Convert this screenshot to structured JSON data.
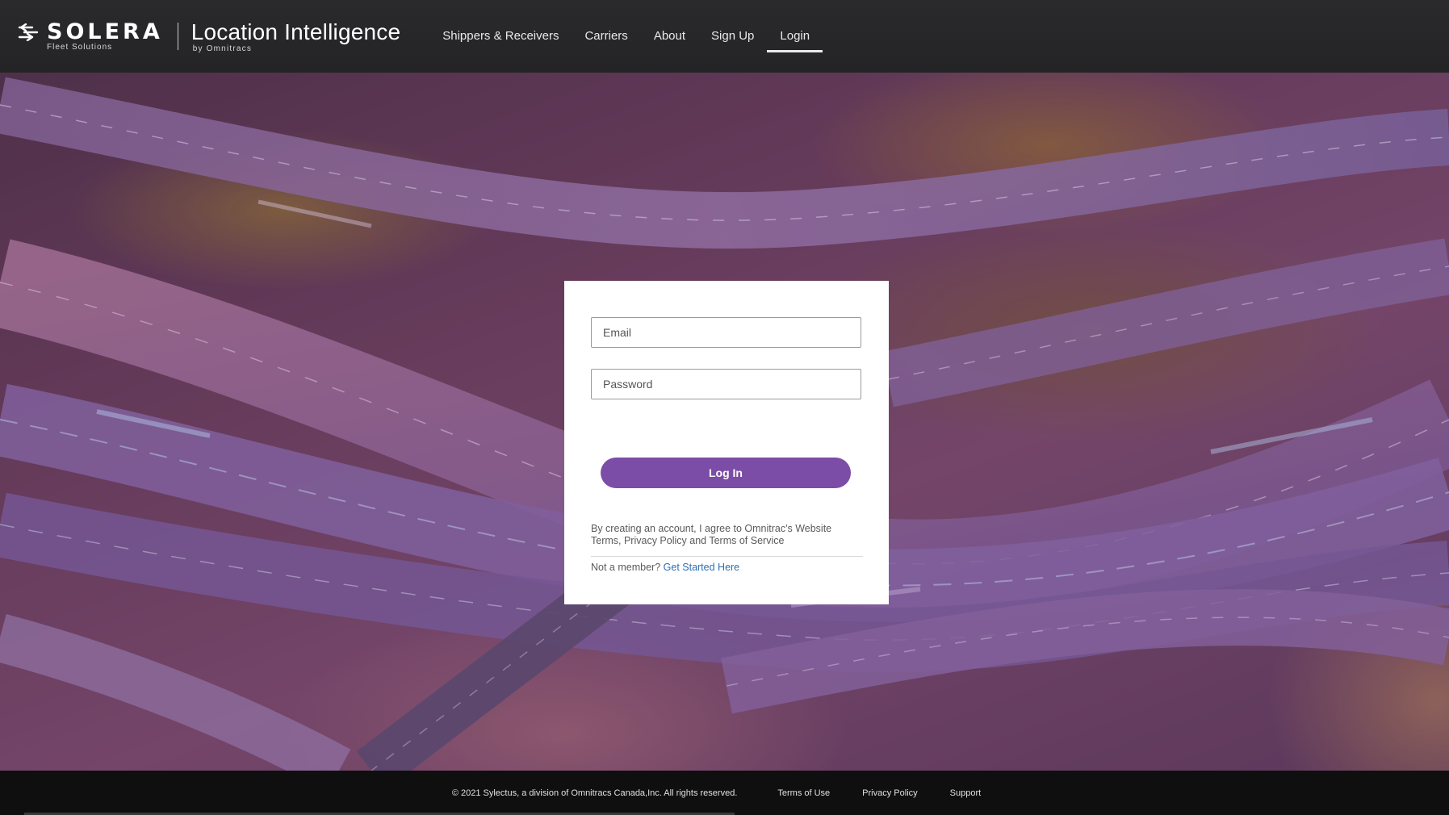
{
  "header": {
    "brand": {
      "solera_name": "SOLERA",
      "solera_sub": "Fleet Solutions",
      "product_name": "Location Intelligence",
      "product_sub": "by Omnitracs"
    },
    "nav": [
      {
        "label": "Shippers & Receivers"
      },
      {
        "label": "Carriers"
      },
      {
        "label": "About"
      },
      {
        "label": "Sign Up"
      },
      {
        "label": "Login",
        "active": true
      }
    ]
  },
  "login": {
    "email_placeholder": "Email",
    "password_placeholder": "Password",
    "submit_label": "Log In",
    "legal_text": "By creating an account, I agree to Omnitrac's Website Terms, Privacy Policy and Terms of Service",
    "not_member_text": "Not a member?",
    "get_started_link": "Get Started Here"
  },
  "footer": {
    "copyright": "© 2021 Sylectus, a division of Omnitracs Canada,Inc. All rights reserved.",
    "links": [
      "Terms of Use",
      "Privacy Policy",
      "Support"
    ]
  },
  "colors": {
    "header_bg": "#252527",
    "footer_bg": "#0f0f10",
    "accent_button": "#7c4da6",
    "link": "#2c6fb0"
  },
  "icons": {
    "brand_mark": "solera-arrows-icon"
  }
}
